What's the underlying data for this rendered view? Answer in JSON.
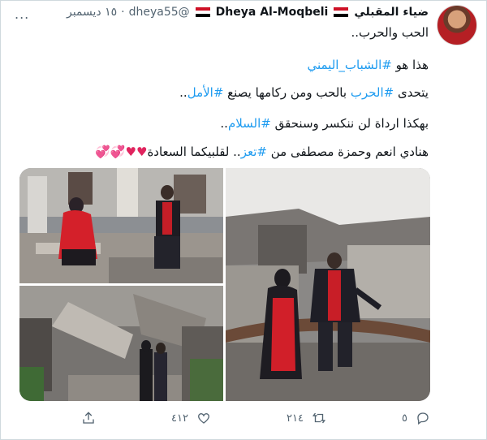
{
  "tweet": {
    "display_name": "ضياء المقبلي",
    "name_latin": "Dheya Al-Moqbeli",
    "handle": "@dheya55",
    "dot": "·",
    "date": "١٥ ديسمبر",
    "more_icon": "...",
    "lines": {
      "line1": "الحب والحرب..",
      "line2_prefix": "هذا هو ",
      "line2_tag": "#الشباب_اليمني",
      "line3_prefix": "يتحدى ",
      "line3_tag1": "#الحرب",
      "line3_middle": " بالحب ومن ركامها يصنع ",
      "line3_tag2": "#الأمل",
      "line3_suffix": "..",
      "line4_prefix": "بهكذا ارداة لن ننكسر وسنحقق ",
      "line4_tag": "#السلام",
      "line4_suffix": "..",
      "line5_prefix": "هنادي انعم وحمزة مصطفى من ",
      "line5_tag": "#تعز",
      "line5_middle": ".. لقلبيكما السعادة",
      "line5_hearts": "♥♥💞💞"
    }
  },
  "actions": {
    "replies": "٥",
    "retweets": "٢١٤",
    "likes": "٤١٢"
  },
  "colors": {
    "hashtag": "#1d9bf0",
    "text": "#0f1419",
    "muted": "#536471",
    "heart": "#e0245e"
  },
  "icons": [
    "more-icon",
    "verified-flag-icon",
    "reply-icon",
    "retweet-icon",
    "like-icon",
    "share-icon"
  ]
}
